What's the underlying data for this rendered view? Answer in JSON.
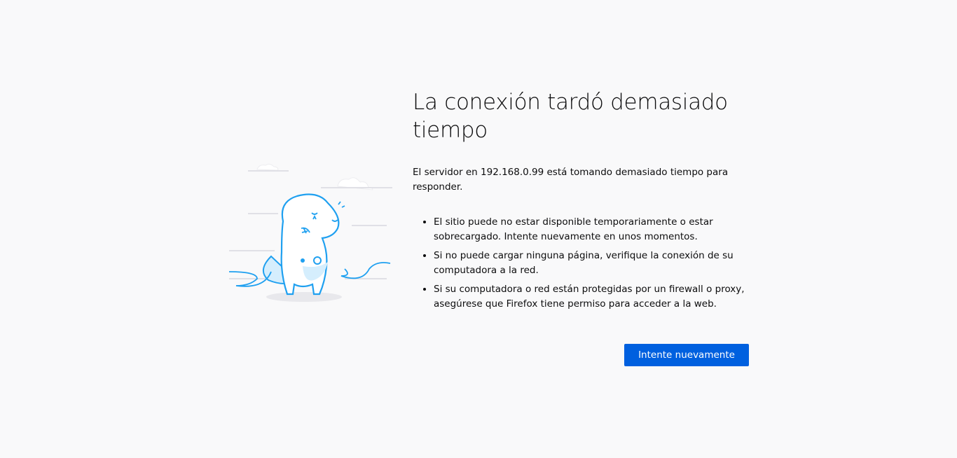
{
  "error": {
    "title": "La conexión tardó demasiado tiempo",
    "description": "El servidor en 192.168.0.99 está tomando demasiado tiempo para responder.",
    "suggestions": [
      "El sitio puede no estar disponible temporariamente o estar sobrecargado. Intente nuevamente en unos momentos.",
      "Si no puede cargar ninguna página, verifique la conexión de su computadora a la red.",
      "Si su computadora o red están protegidas por un firewall o proxy, asegúrese que Firefox tiene permiso para acceder a la web."
    ],
    "retry_label": "Intente nuevamente"
  },
  "colors": {
    "accent": "#0060df",
    "background": "#f9f9fa",
    "illustration": "#1fa0f0"
  }
}
